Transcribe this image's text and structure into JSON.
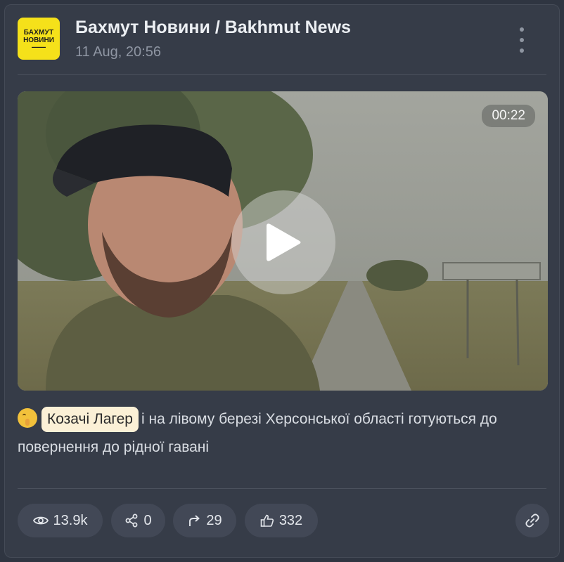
{
  "channel": {
    "logo_line1": "БАХМУТ",
    "logo_line2": "НОВИНИ",
    "name": "Бахмут Новини / Bakhmut News",
    "timestamp": "11 Aug, 20:56"
  },
  "video": {
    "duration": "00:22"
  },
  "post": {
    "chip_text": "Козачі Лагер",
    "text": "і на лівому березі Херсонської області готуються до повернення до рідної гавані"
  },
  "stats": {
    "views": "13.9k",
    "shares": "0",
    "forwards": "29",
    "likes": "332"
  },
  "colors": {
    "background": "#2f3541",
    "card": "#363c48",
    "logo_yellow": "#f5e11a",
    "chip": "#fbf0d6"
  },
  "icons": {
    "menu": "more-vertical-icon",
    "play": "play-icon",
    "views": "eye-icon",
    "shares": "share-nodes-icon",
    "forwards": "forward-arrow-icon",
    "likes": "thumbs-up-icon",
    "link": "link-icon",
    "emoji": "shushing-face-emoji"
  }
}
